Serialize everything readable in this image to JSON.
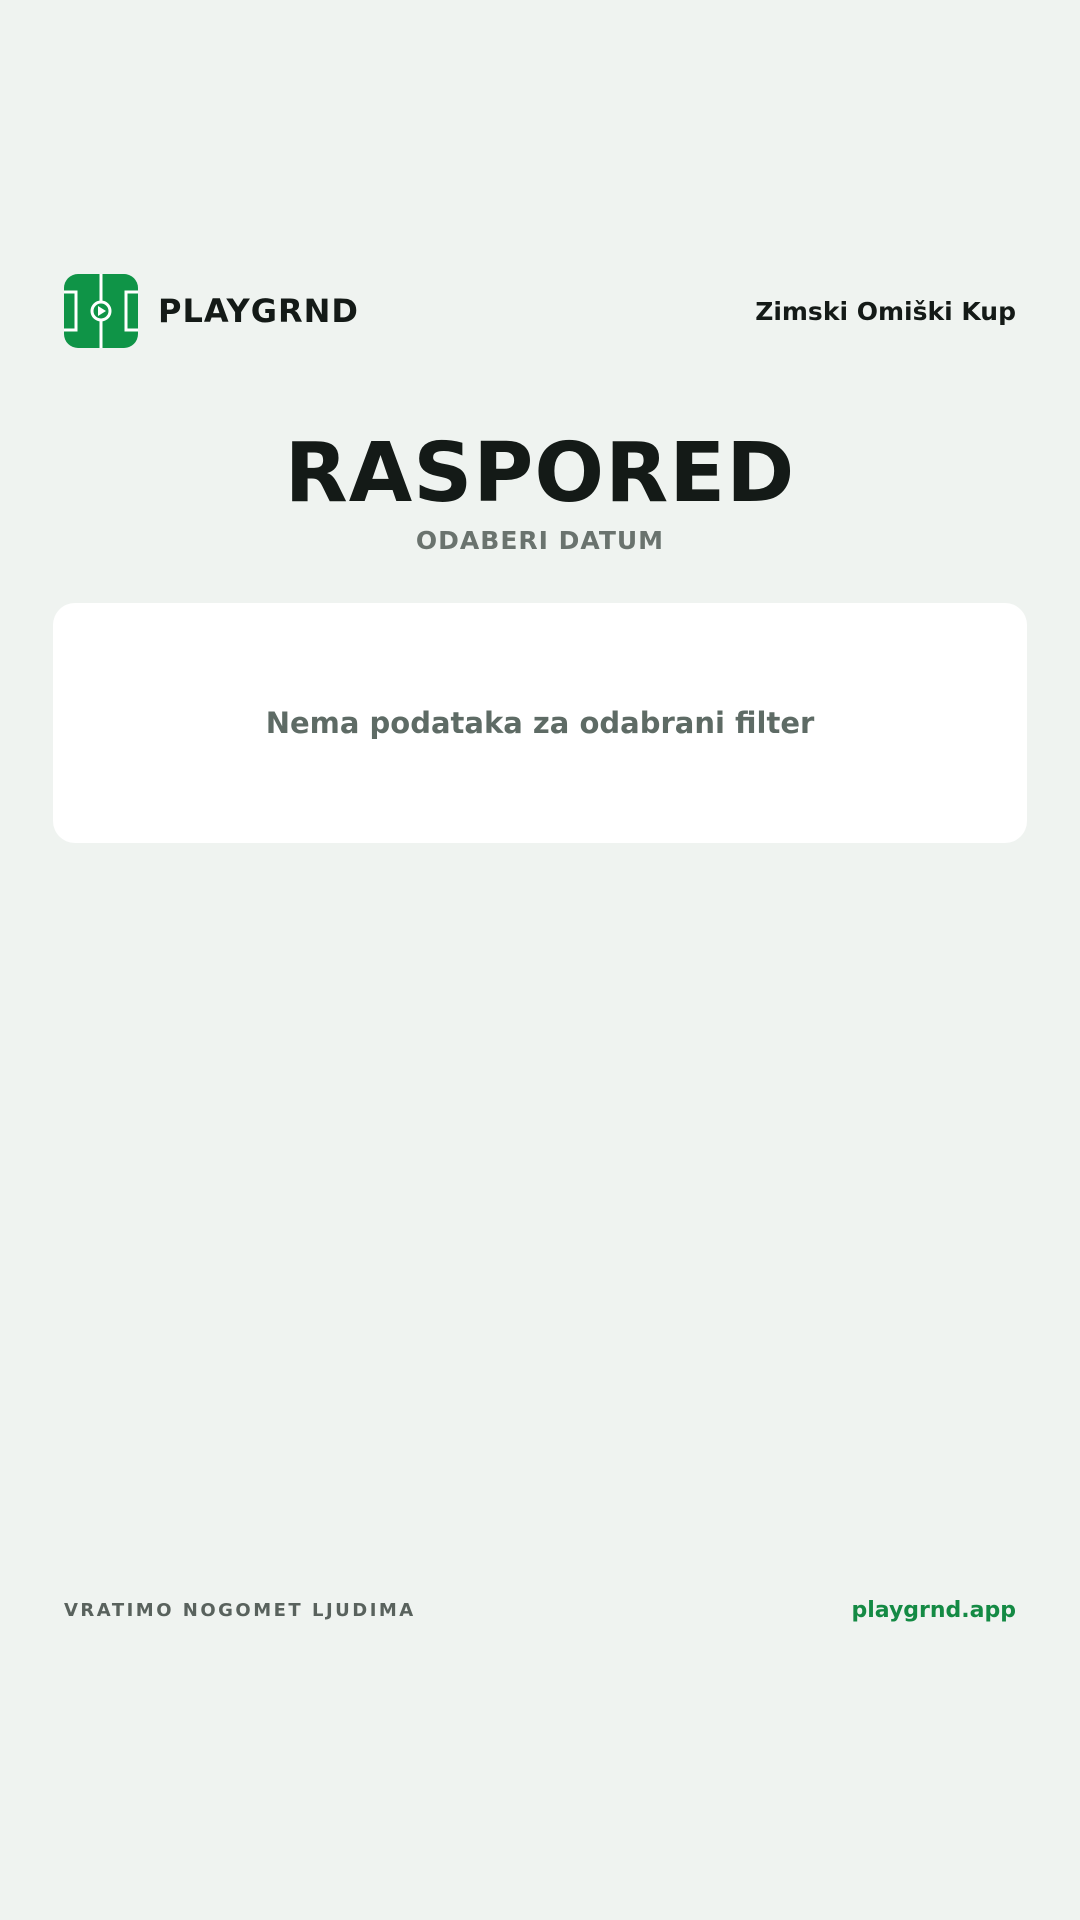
{
  "header": {
    "brand": "PLAYGRND",
    "logo_icon": "football-pitch-icon",
    "tournament": "Zimski Omiški Kup"
  },
  "main": {
    "title": "RASPORED",
    "subtitle": "ODABERI DATUM",
    "empty_message": "Nema podataka za odabrani filter"
  },
  "footer": {
    "tagline": "VRATIMO NOGOMET LJUDIMA",
    "link": "playgrnd.app"
  },
  "colors": {
    "background": "#eff3f0",
    "brand_green": "#0f9447",
    "link_green": "#148a44",
    "text_dark": "#141a17",
    "text_muted": "#6a736e"
  }
}
